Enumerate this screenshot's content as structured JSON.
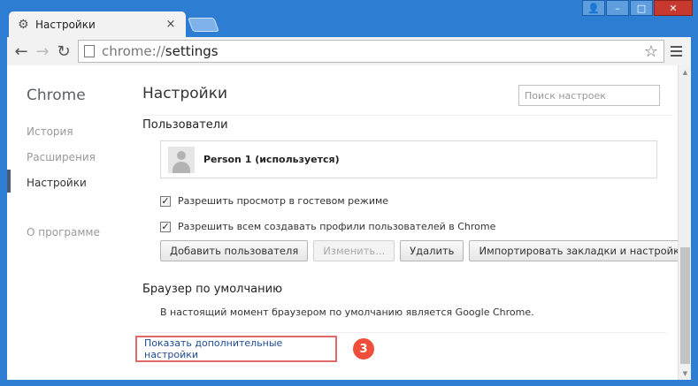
{
  "window": {
    "tab_title": "Настройки",
    "tab_close": "×",
    "controls": {
      "user": "👤",
      "minimize": "–",
      "maximize": "□",
      "close": "✕"
    }
  },
  "toolbar": {
    "back": "←",
    "forward": "→",
    "reload": "↻",
    "url_scheme": "chrome://",
    "url_host": "settings",
    "star": "☆"
  },
  "nav": {
    "title": "Chrome",
    "items": [
      {
        "label": "История"
      },
      {
        "label": "Расширения"
      },
      {
        "label": "Настройки",
        "selected": true
      },
      {
        "label": "О программе"
      }
    ]
  },
  "main": {
    "title": "Настройки",
    "search_placeholder": "Поиск настроек",
    "users": {
      "section_title": "Пользователи",
      "profile_name": "Person 1 (используется)",
      "guest_checkbox": {
        "label": "Разрешить просмотр в гостевом режиме",
        "checked": true,
        "mark": "✓"
      },
      "profiles_checkbox": {
        "label": "Разрешить всем создавать профили пользователей в Chrome",
        "checked": true,
        "mark": "✓"
      },
      "buttons": {
        "add": "Добавить пользователя",
        "edit": "Изменить...",
        "delete": "Удалить",
        "import": "Импортировать закладки и настройки"
      }
    },
    "default_browser": {
      "section_title": "Браузер по умолчанию",
      "status": "В настоящий момент браузером по умолчанию является Google Chrome."
    },
    "advanced_link": "Показать дополнительные настройки",
    "step_badge": "3"
  },
  "colors": {
    "frame": "#2d7dd2",
    "highlight_border": "#e06a6a",
    "badge": "#ef4e3a",
    "link": "#1f4b8f"
  }
}
